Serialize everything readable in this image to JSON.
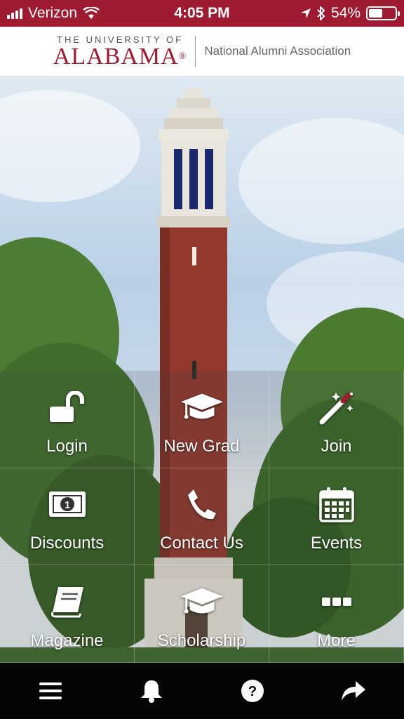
{
  "status_bar": {
    "carrier": "Verizon",
    "time": "4:05 PM",
    "battery_percent": "54%",
    "battery_level": 0.54,
    "icons": [
      "signal-icon",
      "wifi-icon",
      "location-icon",
      "bluetooth-icon",
      "battery-icon"
    ]
  },
  "header": {
    "logo_line1": "THE UNIVERSITY OF",
    "logo_line2": "ALABAMA",
    "logo_mark": "®",
    "subtitle": "National Alumni Association"
  },
  "tiles": [
    {
      "label": "Login",
      "icon": "unlock-icon"
    },
    {
      "label": "New Grad",
      "icon": "graduation-cap-icon"
    },
    {
      "label": "Join",
      "icon": "magic-wand-icon"
    },
    {
      "label": "Discounts",
      "icon": "money-icon"
    },
    {
      "label": "Contact Us",
      "icon": "phone-icon"
    },
    {
      "label": "Events",
      "icon": "calendar-icon"
    },
    {
      "label": "Magazine",
      "icon": "book-icon"
    },
    {
      "label": "Scholarship",
      "icon": "graduation-cap-icon"
    },
    {
      "label": "More",
      "icon": "more-icon"
    }
  ],
  "tabbar": {
    "items": [
      "menu-icon",
      "bell-icon",
      "help-icon",
      "share-icon"
    ]
  },
  "colors": {
    "brand": "#9e1b32",
    "tabbar": "#050505"
  }
}
